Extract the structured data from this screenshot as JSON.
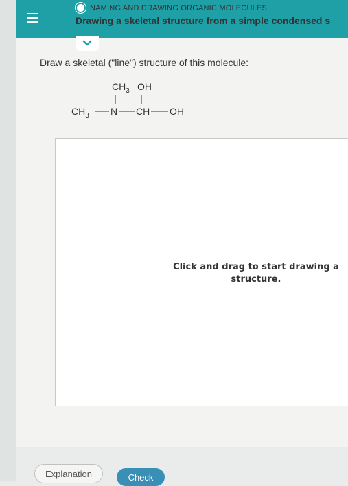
{
  "header": {
    "topic": "NAMING AND DRAWING ORGANIC MOLECULES",
    "title": "Drawing a skeletal structure from a simple condensed s"
  },
  "question": {
    "prompt": "Draw a skeletal (\"line\") structure of this molecule:"
  },
  "molecule": {
    "top_left": "CH",
    "top_left_sub": "3",
    "top_right": "OH",
    "left": "CH",
    "left_sub": "3",
    "nitrogen": "N",
    "center": "CH",
    "right": "OH"
  },
  "canvas": {
    "hint_line1": "Click and drag to start drawing a",
    "hint_line2": "structure."
  },
  "buttons": {
    "explanation": "Explanation",
    "check": "Check"
  },
  "colors": {
    "header_bg": "#1f9fa6",
    "check_bg": "#3a8fb7"
  }
}
